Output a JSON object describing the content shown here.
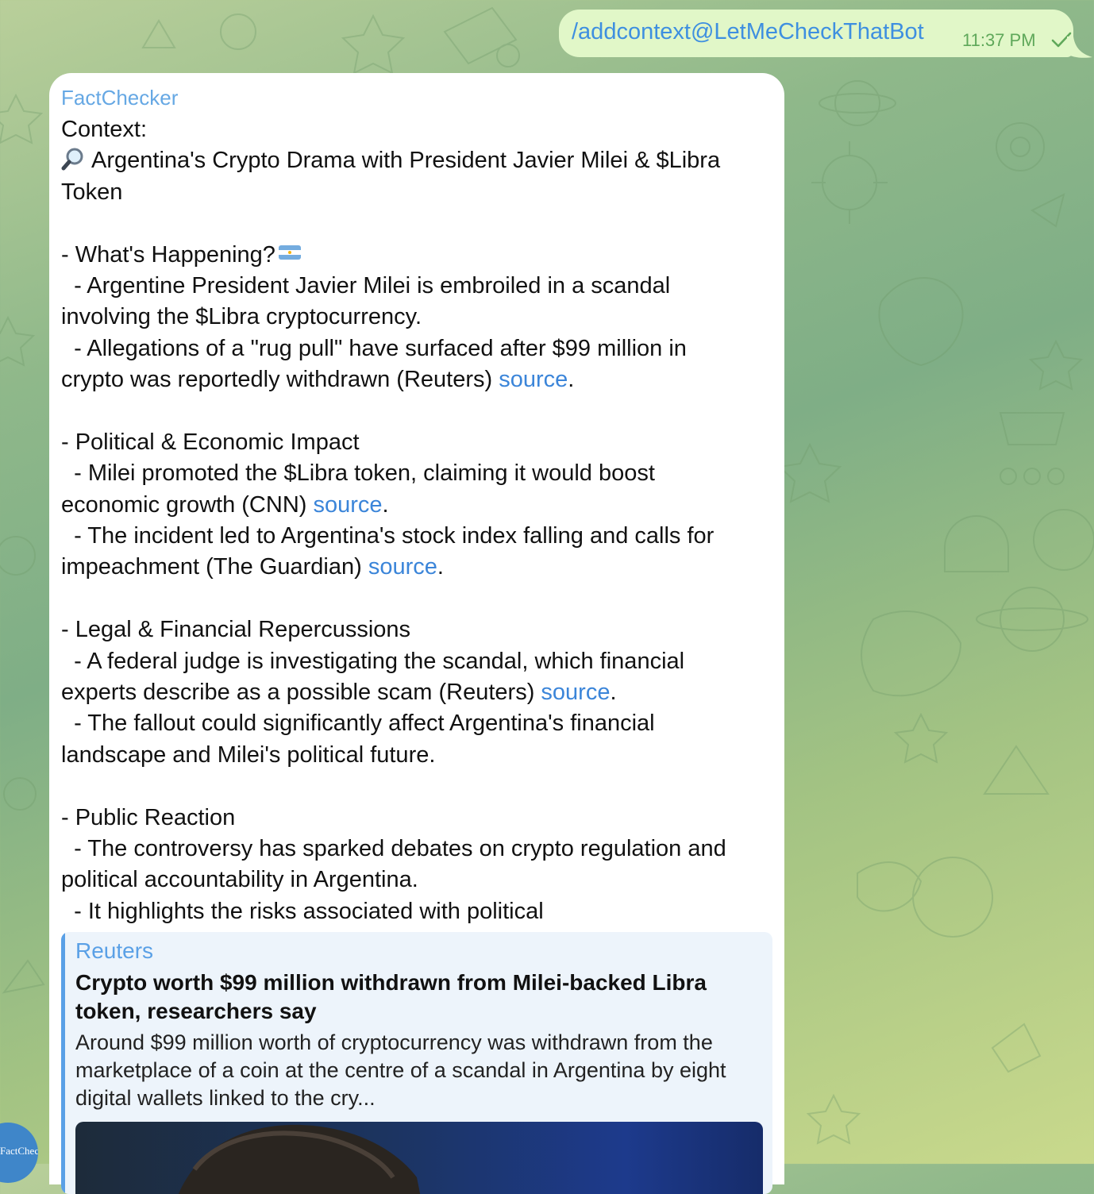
{
  "outgoing": {
    "text": "/addcontext@LetMeCheckThatBot",
    "time": "11:37 PM"
  },
  "incoming": {
    "sender": "FactChecker",
    "lines": {
      "l1": "Context:",
      "l2": "Argentina's Crypto Drama with President Javier Milei & $Libra",
      "l3": "Token",
      "l5": "- What's Happening?",
      "l6": "  - Argentine President Javier Milei is embroiled in a scandal",
      "l7": "involving the $Libra cryptocurrency.",
      "l8": "  - Allegations of a \"rug pull\" have surfaced after $99 million in",
      "l9": "crypto was reportedly withdrawn (Reuters) ",
      "l11": "- Political & Economic Impact",
      "l12": "  - Milei promoted the $Libra token, claiming it would boost",
      "l13": "economic growth (CNN) ",
      "l14": "  - The incident led to Argentina's stock index falling and calls for",
      "l15": "impeachment (The Guardian) ",
      "l17": "- Legal & Financial Repercussions",
      "l18": "  - A federal judge is investigating the scandal, which financial",
      "l19": "experts describe as a possible scam (Reuters) ",
      "l20": "  - The fallout could significantly affect Argentina's financial",
      "l21": "landscape and Milei's political future.",
      "l23": "- Public Reaction",
      "l24": "  - The controversy has sparked debates on crypto regulation and",
      "l25": "political accountability in Argentina.",
      "l26": "  - It highlights the risks associated with political"
    },
    "link_label": "source",
    "period": ".",
    "icons": {
      "magnifier": "magnifying-glass-icon",
      "flag": "argentina-flag-icon"
    },
    "preview": {
      "site": "Reuters",
      "title": "Crypto worth $99 million withdrawn from Milei-backed Libra token, researchers say",
      "description": "Around $99 million worth of cryptocurrency was withdrawn from the marketplace of a coin at the centre of a scandal in Argentina by eight digital wallets linked to the cry..."
    },
    "avatar_text": "FactChecker"
  },
  "colors": {
    "outgoing_bubble": "#e1f7c8",
    "link": "#3b85d9",
    "sender": "#66a8e4",
    "time": "#5fa85a"
  }
}
